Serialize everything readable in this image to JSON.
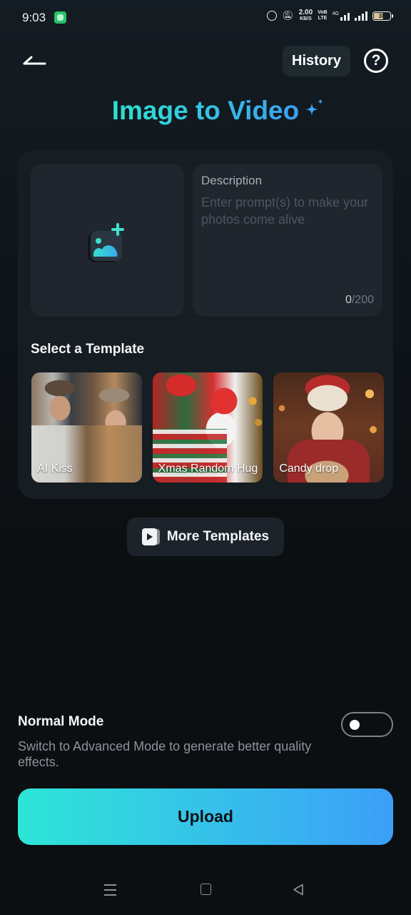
{
  "status_bar": {
    "time": "9:03",
    "net_speed_value": "2.00",
    "net_speed_unit": "KB/S",
    "volte_line1": "VoB",
    "volte_line2": "LTE",
    "network_type": "4G",
    "battery_level": "38"
  },
  "header": {
    "history_label": "History",
    "help_glyph": "?"
  },
  "page": {
    "title": "Image to Video",
    "title_gradient": [
      "#2de2cf",
      "#3c9ff0"
    ]
  },
  "upload_panel": {
    "icon": "add-image-icon"
  },
  "description": {
    "label": "Description",
    "value": "",
    "placeholder": "Enter prompt(s) to make your photos come alive",
    "count_current": "0",
    "count_max": "/200"
  },
  "templates": {
    "heading": "Select a Template",
    "items": [
      {
        "label": "AI Kiss"
      },
      {
        "label": "Xmas Random Hug"
      },
      {
        "label": "Candy drop"
      }
    ],
    "more_label": "More Templates"
  },
  "mode": {
    "title": "Normal Mode",
    "description": "Switch to Advanced Mode to generate better quality effects.",
    "advanced_enabled": false
  },
  "actions": {
    "upload_label": "Upload",
    "upload_gradient": [
      "#2de6d6",
      "#3b9ff8"
    ]
  },
  "nav_bar": {
    "items": [
      "recents",
      "home",
      "back"
    ]
  }
}
